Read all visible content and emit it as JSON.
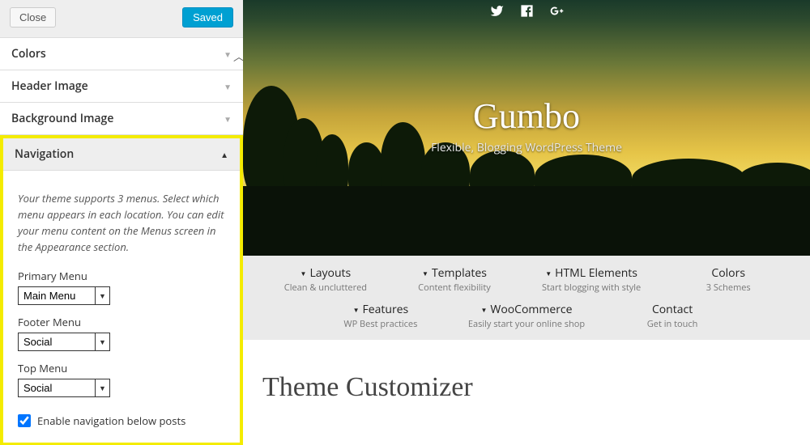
{
  "sidebar": {
    "close_label": "Close",
    "saved_label": "Saved",
    "sections": {
      "colors": "Colors",
      "header_image": "Header Image",
      "background_image": "Background Image",
      "navigation": "Navigation"
    },
    "nav_desc": "Your theme supports 3 menus. Select which menu appears in each location. You can edit your menu content on the Menus screen in the Appearance section.",
    "fields": {
      "primary": {
        "label": "Primary Menu",
        "value": "Main Menu"
      },
      "footer": {
        "label": "Footer Menu",
        "value": "Social"
      },
      "top": {
        "label": "Top Menu",
        "value": "Social"
      }
    },
    "checkbox_label": "Enable navigation below posts"
  },
  "preview": {
    "hero_title": "Gumbo",
    "hero_tagline": "Flexible, Blogging WordPress Theme",
    "menu": [
      {
        "label": "Layouts",
        "sub": "Clean & uncluttered",
        "caret": true
      },
      {
        "label": "Templates",
        "sub": "Content flexibility",
        "caret": true
      },
      {
        "label": "HTML Elements",
        "sub": "Start blogging with style",
        "caret": true
      },
      {
        "label": "Colors",
        "sub": "3 Schemes",
        "caret": false
      },
      {
        "label": "Features",
        "sub": "WP Best practices",
        "caret": true
      },
      {
        "label": "WooCommerce",
        "sub": "Easily start your online shop",
        "caret": true
      },
      {
        "label": "Contact",
        "sub": "Get in touch",
        "caret": false
      }
    ],
    "page_heading": "Theme Customizer"
  }
}
